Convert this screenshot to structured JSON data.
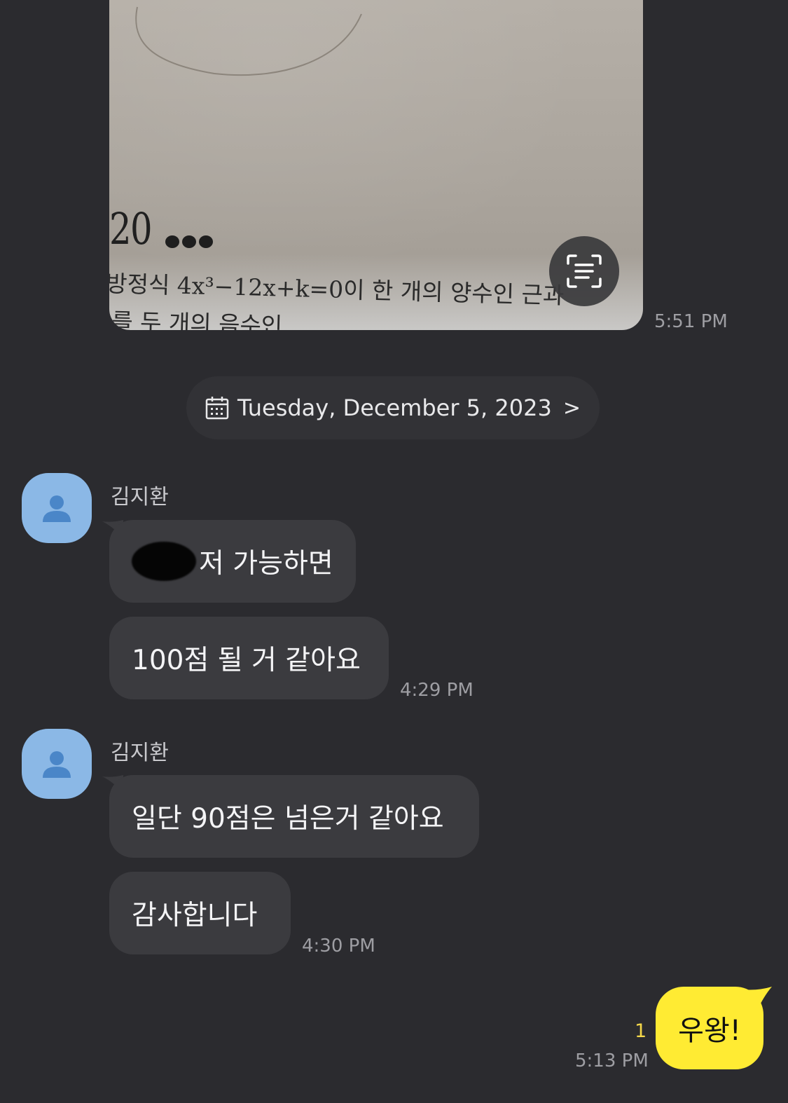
{
  "image_message": {
    "problem_number": "20",
    "problem_line1": "방정식 4x³−12x+k=0이 한 개의 양수인 근과",
    "problem_line2": "를 두 개의 음수인",
    "time": "5:51 PM"
  },
  "date_divider": {
    "label": "Tuesday, December 5, 2023",
    "chevron": ">"
  },
  "groups": [
    {
      "sender": "김지환",
      "messages": [
        "저 가능하면",
        "100점 될 거 같아요"
      ],
      "time": "4:29 PM"
    },
    {
      "sender": "김지환",
      "messages": [
        "일단 90점은 넘은거 같아요",
        "감사합니다"
      ],
      "time": "4:30 PM"
    }
  ],
  "my_message": {
    "text": "우왕!",
    "unread_count": "1",
    "time": "5:13 PM"
  },
  "colors": {
    "background": "#2b2b2f",
    "bubble_incoming": "#3b3b3f",
    "bubble_outgoing": "#ffeb33",
    "avatar": "#8bb8e6",
    "unread": "#f5d84a"
  },
  "icons": [
    "text-scan-icon",
    "calendar-icon",
    "chevron-right-icon",
    "person-icon"
  ]
}
